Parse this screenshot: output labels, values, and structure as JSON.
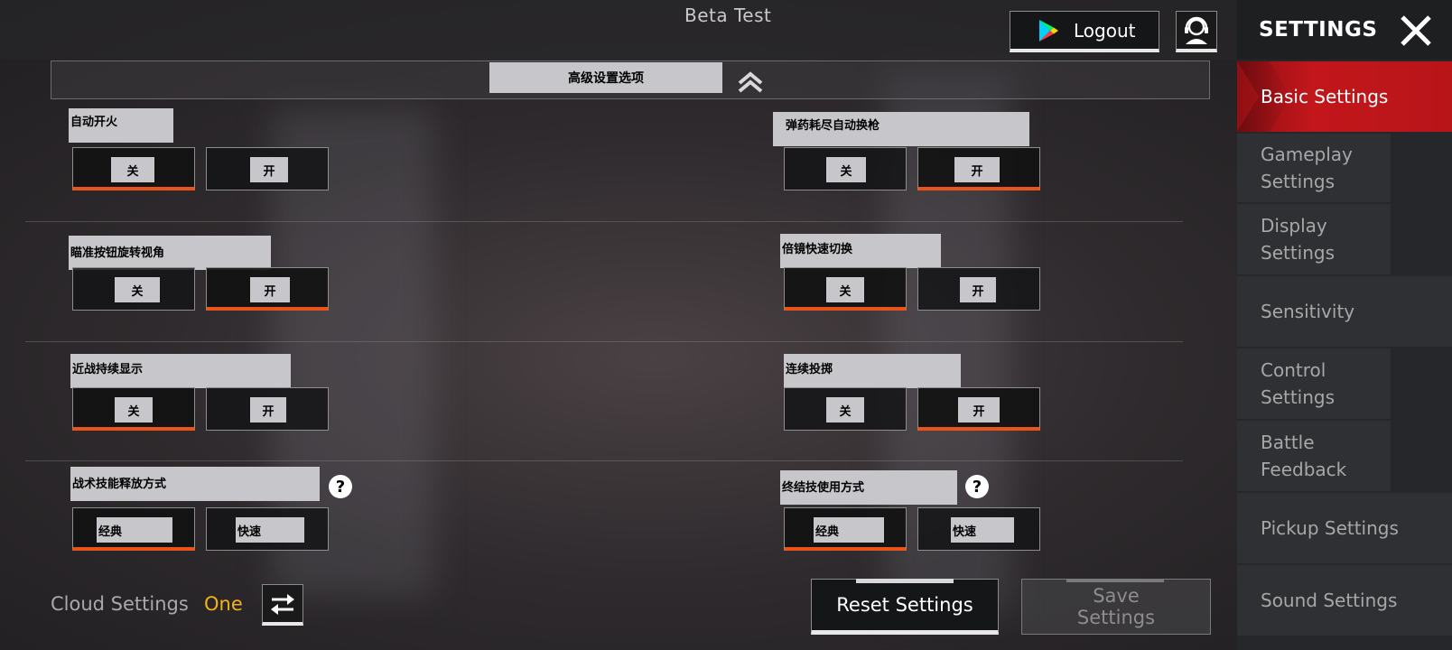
{
  "header": {
    "title": "Beta Test",
    "logout_label": "Logout",
    "support_icon": "headset-support-icon"
  },
  "advanced": {
    "title": "高级设置选项",
    "collapse_icon": "chevron-up-double-icon"
  },
  "settings": {
    "auto_fire": {
      "label": "自动开火",
      "off": "关",
      "on": "开",
      "selected": "off"
    },
    "auto_switch": {
      "label": "弹药耗尽自动换枪",
      "off": "关",
      "on": "开",
      "selected": "on"
    },
    "aim_rotate": {
      "label": "瞄准按钮旋转视角",
      "off": "关",
      "on": "开",
      "selected": "on"
    },
    "scope_switch": {
      "label": "倍镜快速切换",
      "off": "关",
      "on": "开",
      "selected": "off"
    },
    "melee_display": {
      "label": "近战持续显示",
      "off": "关",
      "on": "开",
      "selected": "off"
    },
    "continuous_throw": {
      "label": "连续投掷",
      "off": "关",
      "on": "开",
      "selected": "on"
    },
    "tactical_release": {
      "label": "战术技能释放方式",
      "opt1": "经典",
      "opt2": "快速",
      "selected": "opt1"
    },
    "finisher_mode": {
      "label": "终结技使用方式",
      "opt1": "经典",
      "opt2": "快速",
      "selected": "opt1"
    }
  },
  "footer": {
    "cloud_label": "Cloud Settings",
    "cloud_value": "One",
    "reset_label": "Reset Settings",
    "save_line1": "Save",
    "save_line2": "Settings"
  },
  "sidebar": {
    "title": "SETTINGS",
    "items": [
      {
        "label": "Basic Settings"
      },
      {
        "label": "Gameplay Settings"
      },
      {
        "label": "Display Settings"
      },
      {
        "label": "Sensitivity"
      },
      {
        "label": "Control Settings"
      },
      {
        "label": "Battle Feedback"
      },
      {
        "label": "Pickup Settings"
      },
      {
        "label": "Sound Settings"
      }
    ]
  },
  "colors": {
    "accent_orange": "#e8541a",
    "cloud_value_yellow": "#f2b21a",
    "active_red": "#c2161b"
  }
}
